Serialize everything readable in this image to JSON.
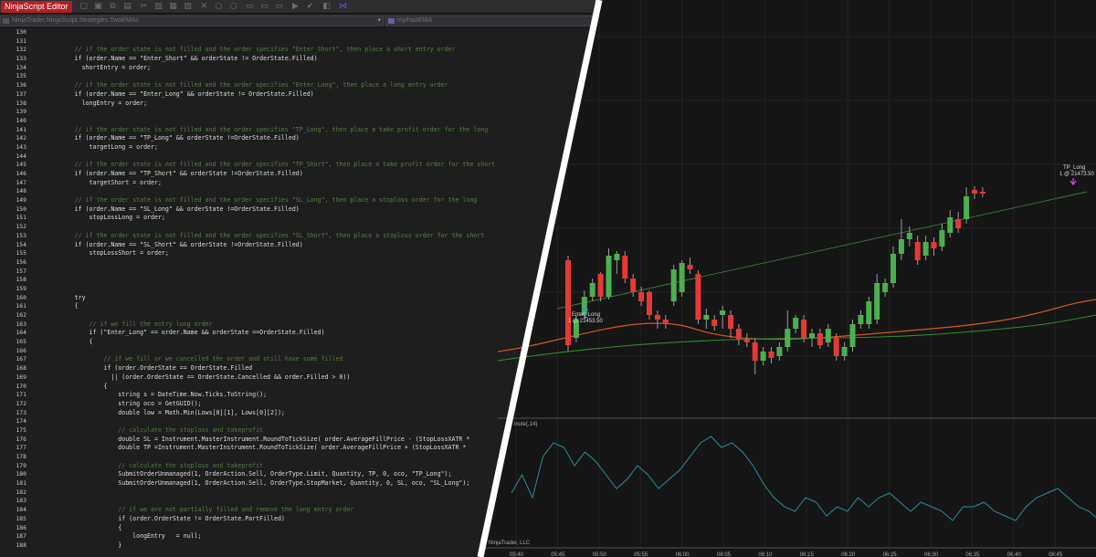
{
  "editor": {
    "title": "NinjaScript Editor",
    "nav_left": "NinjaTrader.NinjaScript.Strategies.TwoEMAs",
    "nav_right": "myFastEMA",
    "lines": [
      {
        "n": "130",
        "text": "",
        "comment": false
      },
      {
        "n": "131",
        "text": "",
        "comment": false
      },
      {
        "n": "132",
        "text": "            // if the order state is not filled and the order specifies \"Enter_Short\", then place a short entry order",
        "comment": true
      },
      {
        "n": "133",
        "text": "            if (order.Name == \"Enter_Short\" && orderState != OrderState.Filled)",
        "comment": false
      },
      {
        "n": "134",
        "text": "              shortEntry = order;",
        "comment": false
      },
      {
        "n": "135",
        "text": "",
        "comment": false
      },
      {
        "n": "136",
        "text": "            // if the order state is not filled and the order specifies \"Enter_Long\", then place a long entry order",
        "comment": true
      },
      {
        "n": "137",
        "text": "            if (order.Name == \"Enter_Long\" && orderState != OrderState.Filled)",
        "comment": false
      },
      {
        "n": "138",
        "text": "              longEntry = order;",
        "comment": false
      },
      {
        "n": "139",
        "text": "",
        "comment": false
      },
      {
        "n": "140",
        "text": "",
        "comment": false
      },
      {
        "n": "141",
        "text": "            // if the order state is not filled and the order specifies \"TP_Long\", then place a take profit order for the long",
        "comment": true
      },
      {
        "n": "142",
        "text": "            if (order.Name == \"TP_Long\" && orderState !=OrderState.Filled)",
        "comment": false
      },
      {
        "n": "143",
        "text": "                targetLong = order;",
        "comment": false
      },
      {
        "n": "144",
        "text": "",
        "comment": false
      },
      {
        "n": "145",
        "text": "            // if the order state is not filled and the order specifies \"TP_Short\", then place a take profit order for the short",
        "comment": true
      },
      {
        "n": "146",
        "text": "            if (order.Name == \"TP_Short\" && orderState !=OrderState.Filled)",
        "comment": false
      },
      {
        "n": "147",
        "text": "                targetShort = order;",
        "comment": false
      },
      {
        "n": "148",
        "text": "",
        "comment": false
      },
      {
        "n": "149",
        "text": "            // if the order state is not filled and the order specifies \"SL_Long\", then place a stoploss order for the long",
        "comment": true
      },
      {
        "n": "150",
        "text": "            if (order.Name == \"SL_Long\" && orderState !=OrderState.Filled)",
        "comment": false
      },
      {
        "n": "151",
        "text": "                stopLossLong = order;",
        "comment": false
      },
      {
        "n": "152",
        "text": "",
        "comment": false
      },
      {
        "n": "153",
        "text": "            // if the order state is not filled and the order specifies \"SL_Short\", then place a stoploss order for the short",
        "comment": true
      },
      {
        "n": "154",
        "text": "            if (order.Name == \"SL_Short\" && orderState !=OrderState.Filled)",
        "comment": false
      },
      {
        "n": "155",
        "text": "                stopLossShort = order;",
        "comment": false
      },
      {
        "n": "156",
        "text": "",
        "comment": false
      },
      {
        "n": "157",
        "text": "",
        "comment": false
      },
      {
        "n": "158",
        "text": "",
        "comment": false
      },
      {
        "n": "159",
        "text": "",
        "comment": false
      },
      {
        "n": "160",
        "text": "            try",
        "comment": false
      },
      {
        "n": "161",
        "text": "            {",
        "comment": false
      },
      {
        "n": "162",
        "text": "",
        "comment": false
      },
      {
        "n": "163",
        "text": "                // if we fill the entry long order",
        "comment": true
      },
      {
        "n": "164",
        "text": "                if (\"Enter_Long\" == order.Name && orderState ==OrderState.Filled)",
        "comment": false
      },
      {
        "n": "165",
        "text": "                {",
        "comment": false
      },
      {
        "n": "166",
        "text": "",
        "comment": false
      },
      {
        "n": "167",
        "text": "                    // if we fill or we cancelled the order and still have some filled",
        "comment": true
      },
      {
        "n": "168",
        "text": "                    if (order.OrderState == OrderState.Filled",
        "comment": false
      },
      {
        "n": "169",
        "text": "                      || (order.OrderState == OrderState.Cancelled && order.Filled > 0))",
        "comment": false
      },
      {
        "n": "170",
        "text": "                    {",
        "comment": false
      },
      {
        "n": "171",
        "text": "                        string s = DateTime.Now.Ticks.ToString();",
        "comment": false
      },
      {
        "n": "172",
        "text": "                        string oco = GetGUID();",
        "comment": false
      },
      {
        "n": "173",
        "text": "                        double low = Math.Min(Lows[0][1], Lows[0][2]);",
        "comment": false
      },
      {
        "n": "174",
        "text": "",
        "comment": false
      },
      {
        "n": "175",
        "text": "                        // calculate the stoploss and takeprofit",
        "comment": true
      },
      {
        "n": "176",
        "text": "                        double SL = Instrument.MasterInstrument.RoundToTickSize( order.AverageFillPrice - (StopLossXATR *",
        "comment": false
      },
      {
        "n": "177",
        "text": "                        double TP =Instrument.MasterInstrument.RoundToTickSize( order.AverageFillPrice + (StopLossXATR *",
        "comment": false
      },
      {
        "n": "178",
        "text": "",
        "comment": false
      },
      {
        "n": "179",
        "text": "                        // calculate the stoploss and takeprofit",
        "comment": true
      },
      {
        "n": "180",
        "text": "                        SubmitOrderUnmanaged(1, OrderAction.Sell, OrderType.Limit, Quantity, TP, 0, oco, \"TP_Long\");",
        "comment": false
      },
      {
        "n": "181",
        "text": "                        SubmitOrderUnmanaged(1, OrderAction.Sell, OrderType.StopMarket, Quantity, 0, SL, oco, \"SL_Long\");",
        "comment": false
      },
      {
        "n": "182",
        "text": "",
        "comment": false
      },
      {
        "n": "183",
        "text": "",
        "comment": false
      },
      {
        "n": "184",
        "text": "                        // if we are not partially filled and remove the long entry order",
        "comment": true
      },
      {
        "n": "185",
        "text": "                        if (order.OrderState != OrderState.PartFilled)",
        "comment": false
      },
      {
        "n": "186",
        "text": "                        {",
        "comment": false
      },
      {
        "n": "187",
        "text": "                            longEntry   = null;",
        "comment": false
      },
      {
        "n": "188",
        "text": "                        }",
        "comment": false
      }
    ]
  },
  "chart": {
    "trade_entry_name": "Enter_Long",
    "trade_entry_fill": "1 @ 21453.50",
    "trade_exit_name": "TP_Long",
    "trade_exit_fill": "1 @ 21473.50",
    "indicator_label": "inute(,14)",
    "copyright": "NinjaTrader, LLC",
    "time_labels": [
      "05:40",
      "05:45",
      "05:50",
      "05:55",
      "06:00",
      "06:05",
      "06:10",
      "06:15",
      "06:20",
      "06:25",
      "06:30",
      "06:35",
      "06:40",
      "06:45"
    ],
    "colors": {
      "up": "#4caf50",
      "down": "#e53935",
      "fast_ema": "#d2561e",
      "slow_ema": "#2e8b2e",
      "trend": "#3a7a3a",
      "indicator": "#2a8a9a"
    }
  }
}
